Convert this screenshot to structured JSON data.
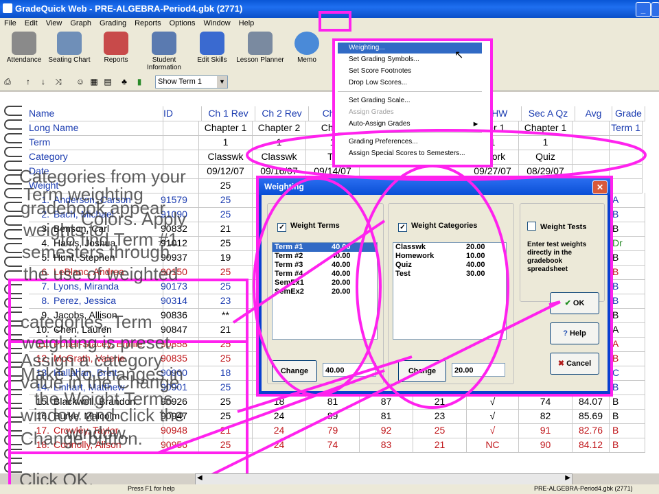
{
  "window": {
    "title": "GradeQuick Web - PRE-ALGEBRA-Period4.gbk (2771)"
  },
  "menu": [
    "File",
    "Edit",
    "View",
    "Graph",
    "Grading",
    "Reports",
    "Options",
    "Window",
    "Help"
  ],
  "toolbar": [
    {
      "label": "Attendance",
      "icon": "calendar-icon"
    },
    {
      "label": "Seating Chart",
      "icon": "desk-icon"
    },
    {
      "label": "Reports",
      "icon": "reports-icon"
    },
    {
      "label": "Student Information",
      "icon": "student-info-icon"
    },
    {
      "label": "Edit Skills",
      "icon": "skills-icon"
    },
    {
      "label": "Lesson Planner",
      "icon": "planner-icon"
    },
    {
      "label": "Memo",
      "icon": "memo-icon"
    }
  ],
  "showterm": {
    "value": "Show Term 1"
  },
  "columns": [
    "Name",
    "ID",
    "Ch 1 Rev",
    "Ch 2 Rev",
    "Ch1 T",
    "A HW",
    "Sec A Qz",
    "Avg",
    "Grade"
  ],
  "header_rows": [
    {
      "label": "Long Name",
      "cells": [
        "",
        "Chapter 1",
        "Chapter 2",
        "Chap",
        "pter 1",
        "Chapter 1",
        "",
        "Term 1"
      ]
    },
    {
      "label": "Term",
      "cells": [
        "",
        "1",
        "1",
        "1",
        "1",
        "1",
        "",
        ""
      ]
    },
    {
      "label": "Category",
      "cells": [
        "",
        "Classwk",
        "Classwk",
        "Te",
        "ework",
        "Quiz",
        "",
        ""
      ]
    },
    {
      "label": "Date",
      "cells": [
        "",
        "09/12/07",
        "09/16/07",
        "09/14/07",
        "09/27/07",
        "08/29/07",
        "",
        ""
      ]
    },
    {
      "label": "Weight",
      "cells": [
        "",
        "25",
        "",
        "",
        "",
        "",
        "",
        ""
      ]
    }
  ],
  "students": [
    {
      "num": "1.",
      "name": "Anderson, Carson",
      "id": "91579",
      "c1": "25",
      "grade": "A",
      "color": "blue"
    },
    {
      "num": "2.",
      "name": "Bach, Michael",
      "id": "91090",
      "c1": "25",
      "grade": "B",
      "color": "blue"
    },
    {
      "num": "3.",
      "name": "Benson, Carl",
      "id": "90832",
      "c1": "21",
      "grade": "B",
      "color": "black"
    },
    {
      "num": "4.",
      "name": "Harris, Joshua",
      "id": "91012",
      "c1": "25",
      "grade": "Dr",
      "color": "black"
    },
    {
      "num": "5.",
      "name": "Hunt, Stephen",
      "id": "90937",
      "c1": "19",
      "grade": "B",
      "color": "black"
    },
    {
      "num": "6.",
      "name": "LeBlanc, Andrea",
      "id": "90150",
      "c1": "25",
      "grade": "B",
      "color": "red"
    },
    {
      "num": "7.",
      "name": "Lyons, Miranda",
      "id": "90173",
      "c1": "25",
      "grade": "B",
      "color": "blue"
    },
    {
      "num": "8.",
      "name": "Perez, Jessica",
      "id": "90314",
      "c1": "23",
      "grade": "B",
      "color": "blue"
    },
    {
      "num": "9.",
      "name": "Jacobs, Allison",
      "id": "90836",
      "c1": "**",
      "grade": "B",
      "color": "black"
    },
    {
      "num": "10.",
      "name": "Chen, Lauren",
      "id": "90847",
      "c1": "21",
      "grade": "A",
      "color": "black"
    },
    {
      "num": "11.",
      "name": "Potter-Stacey, Emilie",
      "id": "90858",
      "c1": "25",
      "grade": "A",
      "color": "red"
    },
    {
      "num": "12.",
      "name": "McGrath, Valerie",
      "id": "90835",
      "c1": "25",
      "grade": "B",
      "color": "red"
    },
    {
      "num": "13.",
      "name": "Hallahan, Brett",
      "id": "90900",
      "c1": "18",
      "c2": "93",
      "c3": "96",
      "c4": "44",
      "c5": "NC",
      "c6": "79",
      "avg": "77.75",
      "grade": "C",
      "color": "blue"
    },
    {
      "num": "14.",
      "name": "Linhart, Matthew",
      "id": "90901",
      "c1": "25",
      "c2": "22",
      "c3": "95",
      "c4": "88",
      "c5": "25",
      "c6": "√",
      "c7": "67",
      "avg": "88.07",
      "grade": "B",
      "color": "blue"
    },
    {
      "num": "15.",
      "name": "Blackwell, Brandon",
      "id": "90926",
      "c1": "25",
      "c2": "18",
      "c3": "81",
      "c4": "87",
      "c5": "21",
      "c6": "√",
      "c7": "74",
      "avg": "84.07",
      "grade": "B",
      "color": "black"
    },
    {
      "num": "16.",
      "name": "Burke, Malcolm",
      "id": "90947",
      "c1": "25",
      "c2": "24",
      "c3": "89",
      "c4": "81",
      "c5": "23",
      "c6": "√",
      "c7": "82",
      "avg": "85.69",
      "grade": "B",
      "color": "black"
    },
    {
      "num": "17.",
      "name": "Crowley, Taylor",
      "id": "90948",
      "c1": "21",
      "c2": "24",
      "c3": "79",
      "c4": "92",
      "c5": "25",
      "c6": "√",
      "c7": "91",
      "avg": "82.76",
      "grade": "B",
      "color": "red"
    },
    {
      "num": "18.",
      "name": "Connolly, Alison",
      "id": "90956",
      "c1": "25",
      "c2": "24",
      "c3": "74",
      "c4": "83",
      "c5": "21",
      "c6": "NC",
      "c7": "90",
      "avg": "84.12",
      "grade": "B",
      "color": "red"
    }
  ],
  "dropdown": {
    "items": [
      {
        "label": "Weighting...",
        "state": "selected"
      },
      {
        "label": "Set Grading Symbols...",
        "state": "normal"
      },
      {
        "label": "Set Score Footnotes",
        "state": "normal"
      },
      {
        "label": "Drop Low Scores...",
        "state": "normal"
      },
      {
        "label": "Set Grading Scale...",
        "state": "normal"
      },
      {
        "label": "Assign Grades",
        "state": "disabled"
      },
      {
        "label": "Auto-Assign Grades",
        "state": "submenu"
      },
      {
        "label": "Grading Preferences...",
        "state": "normal"
      },
      {
        "label": "Assign Special Scores to Semesters...",
        "state": "normal"
      }
    ]
  },
  "dialog": {
    "title": "Weighting",
    "weight_terms": {
      "label": "Weight Terms",
      "checked": true,
      "items": [
        {
          "name": "Term #1",
          "value": "40.00",
          "selected": true
        },
        {
          "name": "Term #2",
          "value": "40.00"
        },
        {
          "name": "Term #3",
          "value": "40.00"
        },
        {
          "name": "Term #4",
          "value": "40.00"
        },
        {
          "name": "SemEx1",
          "value": "20.00"
        },
        {
          "name": "SemEx2",
          "value": "20.00"
        }
      ],
      "change_label": "Change",
      "field_value": "40.00"
    },
    "weight_categories": {
      "label": "Weight Categories",
      "checked": true,
      "items": [
        {
          "name": "Classwk",
          "value": "20.00"
        },
        {
          "name": "Homework",
          "value": "10.00"
        },
        {
          "name": "Quiz",
          "value": "40.00"
        },
        {
          "name": "Test",
          "value": "30.00"
        }
      ],
      "change_label": "Change",
      "field_value": "20.00"
    },
    "weight_tests": {
      "label": "Weight Tests",
      "checked": false,
      "hint": "Enter test weights directly in the gradebook spreadsheet"
    },
    "ok_label": "OK",
    "help_label": "Help",
    "cancel_label": "Cancel"
  },
  "overlay_text": [
    "Categories from your",
    "gradebook appear",
    "Term weighting",
    "Colors. Apply",
    "to find Term #1",
    "weights to",
    "semesters through",
    "the use of weighted",
    "categories. Term",
    "weighting is preset.",
    "Assign a category",
    "value in the Change",
    "window and click the",
    "Change button.",
    "Make No changes in",
    "the Weight Terms",
    "window.",
    "Click OK."
  ],
  "status": {
    "left": "Press F1 for help",
    "right": "PRE-ALGEBRA-Period4.gbk (2771)"
  },
  "colors": {
    "highlight": "#ff22ee",
    "accent": "#316ac5"
  }
}
